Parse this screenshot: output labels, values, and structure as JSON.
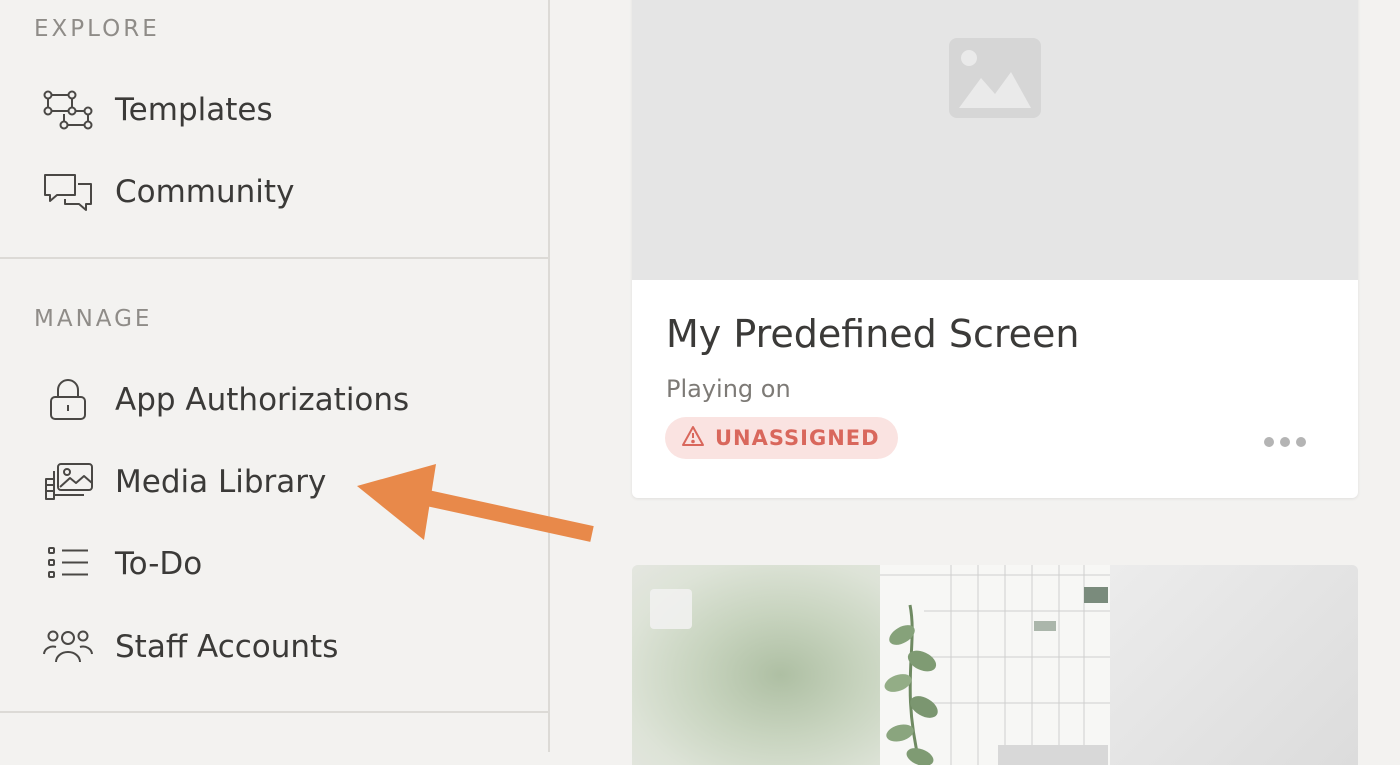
{
  "sidebar": {
    "explore_label": "EXPLORE",
    "manage_label": "MANAGE",
    "explore_items": [
      {
        "label": "Templates",
        "icon": "templates-icon"
      },
      {
        "label": "Community",
        "icon": "community-icon"
      }
    ],
    "manage_items": [
      {
        "label": "App Authorizations",
        "icon": "lock-icon"
      },
      {
        "label": "Media Library",
        "icon": "media-library-icon"
      },
      {
        "label": "To-Do",
        "icon": "todo-list-icon"
      },
      {
        "label": "Staff Accounts",
        "icon": "users-icon"
      }
    ]
  },
  "main": {
    "card": {
      "title": "My Predefined Screen",
      "subtitle": "Playing on",
      "status_badge": "UNASSIGNED"
    }
  },
  "colors": {
    "sidebar_bg": "#f3f2f0",
    "badge_bg": "#fae3e1",
    "badge_text": "#d9675c",
    "arrow": "#e8894a"
  }
}
